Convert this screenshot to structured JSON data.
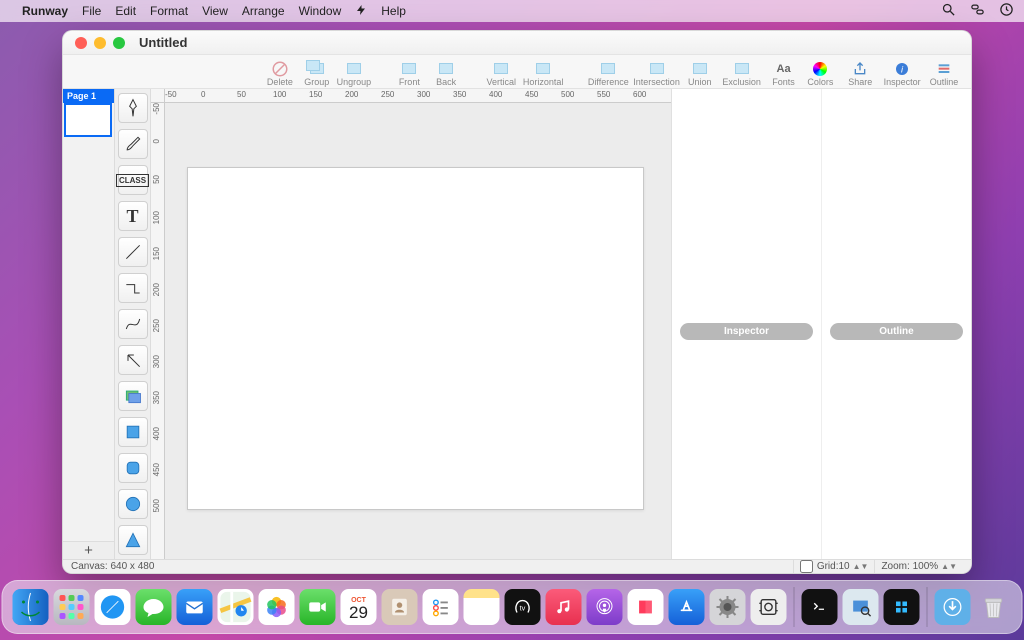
{
  "menubar": {
    "app": "Runway",
    "items": [
      "File",
      "Edit",
      "Format",
      "View",
      "Arrange",
      "Window"
    ],
    "help": "Help"
  },
  "window": {
    "title": "Untitled"
  },
  "toolbar": {
    "delete": "Delete",
    "group": "Group",
    "ungroup": "Ungroup",
    "front": "Front",
    "back": "Back",
    "vertical": "Vertical",
    "horizontal": "Horizontal",
    "difference": "Difference",
    "intersection": "Intersection",
    "union": "Union",
    "exclusion": "Exclusion",
    "fonts": "Fonts",
    "colors": "Colors",
    "share": "Share",
    "inspector": "Inspector",
    "outline": "Outline"
  },
  "pages": {
    "page1": "Page 1",
    "add": "+"
  },
  "tools": {
    "class_label": "CLASS",
    "text_label": "T"
  },
  "right_panels": {
    "inspector": "Inspector",
    "outline": "Outline"
  },
  "ruler": {
    "h": [
      "-50",
      "0",
      "50",
      "100",
      "150",
      "200",
      "250",
      "300",
      "350",
      "400",
      "450",
      "500",
      "550",
      "600"
    ],
    "v": [
      "-50",
      "0",
      "50",
      "100",
      "150",
      "200",
      "250",
      "300",
      "350",
      "400",
      "450",
      "500"
    ]
  },
  "status": {
    "canvas": "Canvas: 640 x 480",
    "grid": "Grid:10",
    "zoom": "Zoom: 100%"
  },
  "dock": {
    "items": [
      "finder",
      "launchpad",
      "safari",
      "messages",
      "mail",
      "maps",
      "photos",
      "facetime",
      "calendar",
      "contacts",
      "reminders",
      "notes",
      "tv",
      "music",
      "podcasts",
      "news",
      "appstore",
      "settings",
      "screenshot"
    ],
    "after_sep": [
      "terminal",
      "preview",
      "runway"
    ],
    "after_sep2": [
      "downloads",
      "trash"
    ],
    "calendar_month": "OCT",
    "calendar_day": "29"
  }
}
